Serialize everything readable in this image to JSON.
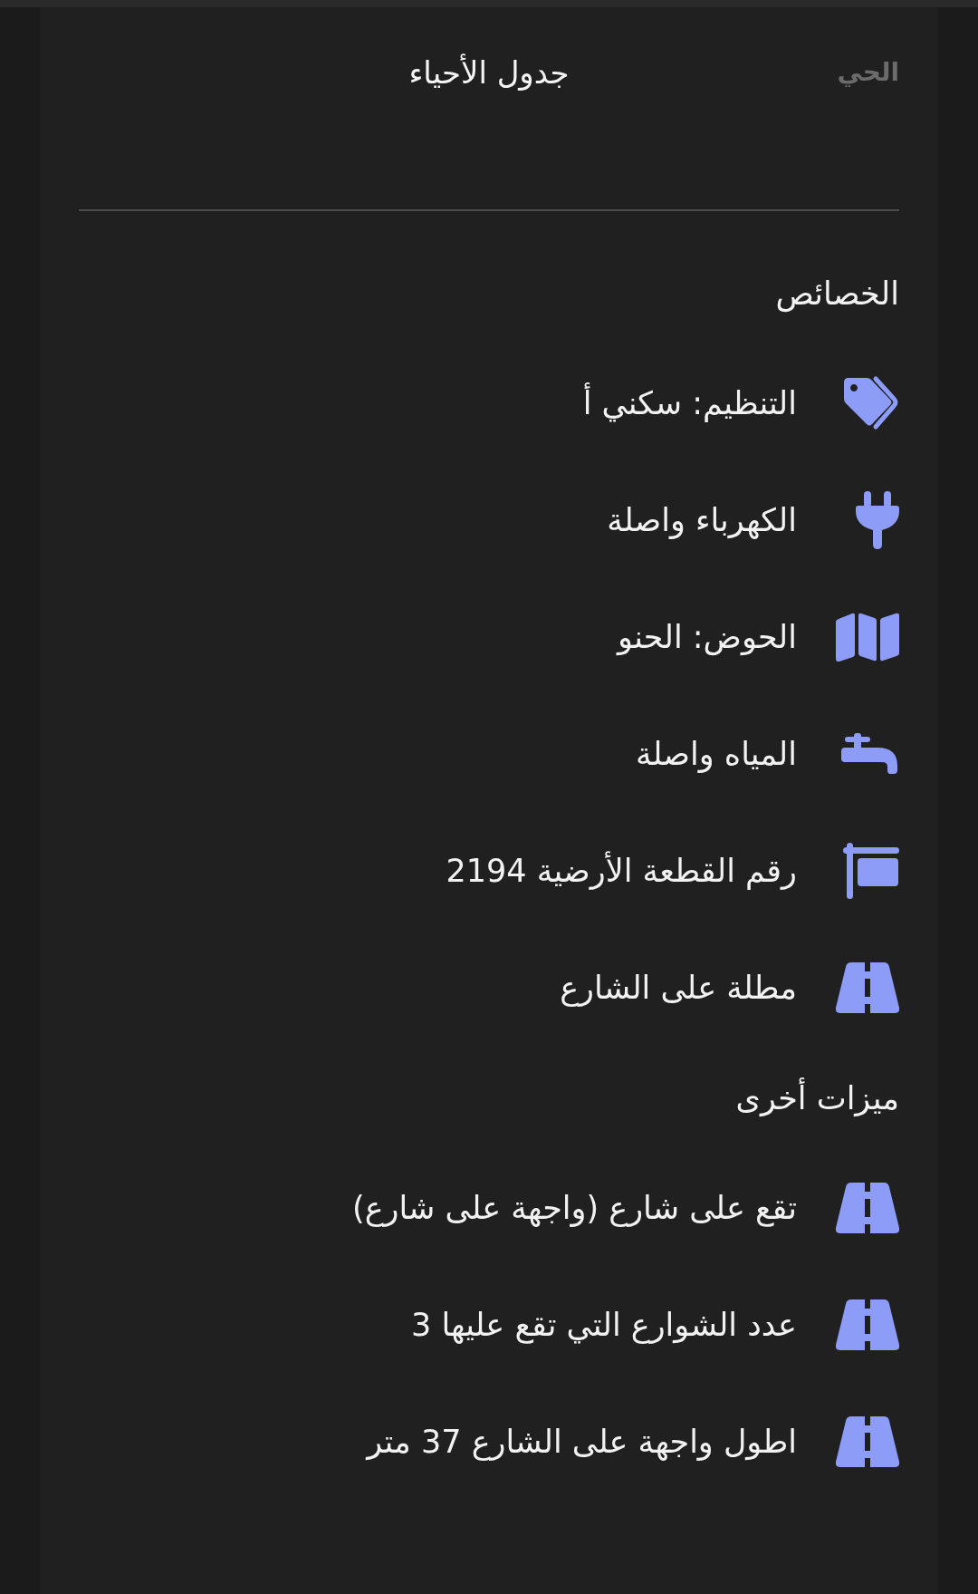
{
  "header": {
    "side_label": "الحي",
    "title": "جدول الأحياء"
  },
  "sections": [
    {
      "title": "الخصائص",
      "items": [
        {
          "kind": "tag",
          "text": "التنظيم: سكني أ"
        },
        {
          "kind": "plug",
          "text": "الكهرباء واصلة"
        },
        {
          "kind": "map",
          "text": "الحوض: الحنو"
        },
        {
          "kind": "faucet",
          "text": "المياه واصلة"
        },
        {
          "kind": "signpost",
          "text": "رقم القطعة الأرضية 2194"
        },
        {
          "kind": "road",
          "text": "مطلة على الشارع"
        }
      ]
    },
    {
      "title": "ميزات أخرى",
      "items": [
        {
          "kind": "road",
          "text": "تقع على شارع (واجهة على شارع)"
        },
        {
          "kind": "road",
          "text": "عدد الشوارع التي تقع عليها 3"
        },
        {
          "kind": "road",
          "text": "اطول واجهة على الشارع 37 متر"
        }
      ]
    }
  ]
}
